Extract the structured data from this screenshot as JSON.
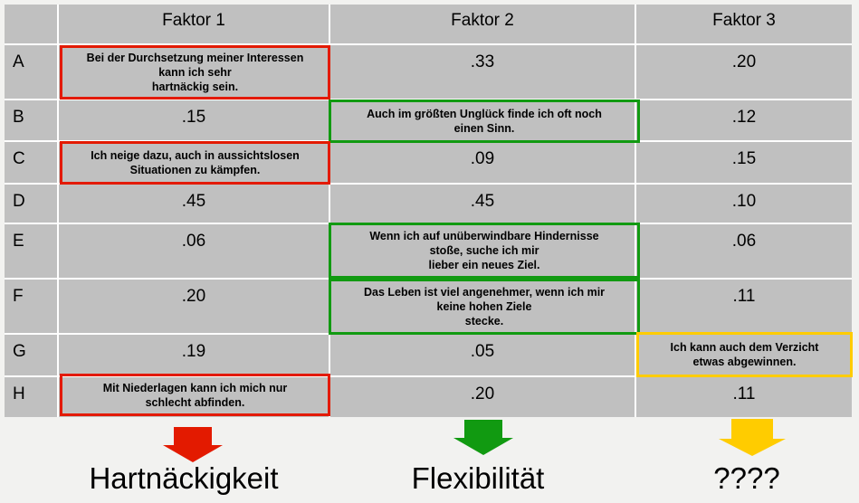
{
  "headers": [
    "Faktor 1",
    "Faktor 2",
    "Faktor 3"
  ],
  "rows": [
    {
      "label": "A",
      "values": [
        "",
        ".33",
        ".20"
      ]
    },
    {
      "label": "B",
      "values": [
        ".15",
        "",
        ".12"
      ]
    },
    {
      "label": "C",
      "values": [
        "",
        ".09",
        ".15"
      ]
    },
    {
      "label": "D",
      "values": [
        ".45",
        ".45",
        ".10"
      ]
    },
    {
      "label": "E",
      "values": [
        ".06",
        "",
        ".06"
      ]
    },
    {
      "label": "F",
      "values": [
        ".20",
        "",
        ".11"
      ]
    },
    {
      "label": "G",
      "values": [
        ".19",
        ".05",
        ""
      ]
    },
    {
      "label": "H",
      "values": [
        "",
        ".20",
        ".11"
      ]
    }
  ],
  "statements": {
    "A": "Bei der Durchsetzung meiner Interessen\nkann ich sehr\nhartnäckig sein.",
    "B": "Auch im größten Unglück finde ich oft noch\neinen Sinn.",
    "C": "Ich neige dazu, auch in aussichtslosen\nSituationen zu kämpfen.",
    "E": "Wenn ich auf unüberwindbare Hindernisse\nstoße, suche ich mir\nlieber ein neues Ziel.",
    "F": "Das Leben ist viel angenehmer, wenn ich mir\nkeine hohen Ziele\nstecke.",
    "G": "Ich kann auch dem Verzicht\netwas abgewinnen.",
    "H": "Mit Niederlagen kann ich mich nur\nschlecht abfinden."
  },
  "factor_labels": [
    "Hartnäckigkeit",
    "Flexibilität",
    "????"
  ],
  "colors": {
    "factor1": "#e31a00",
    "factor2": "#119a11",
    "factor3": "#ffcc00",
    "cell": "#c0c0c0"
  }
}
